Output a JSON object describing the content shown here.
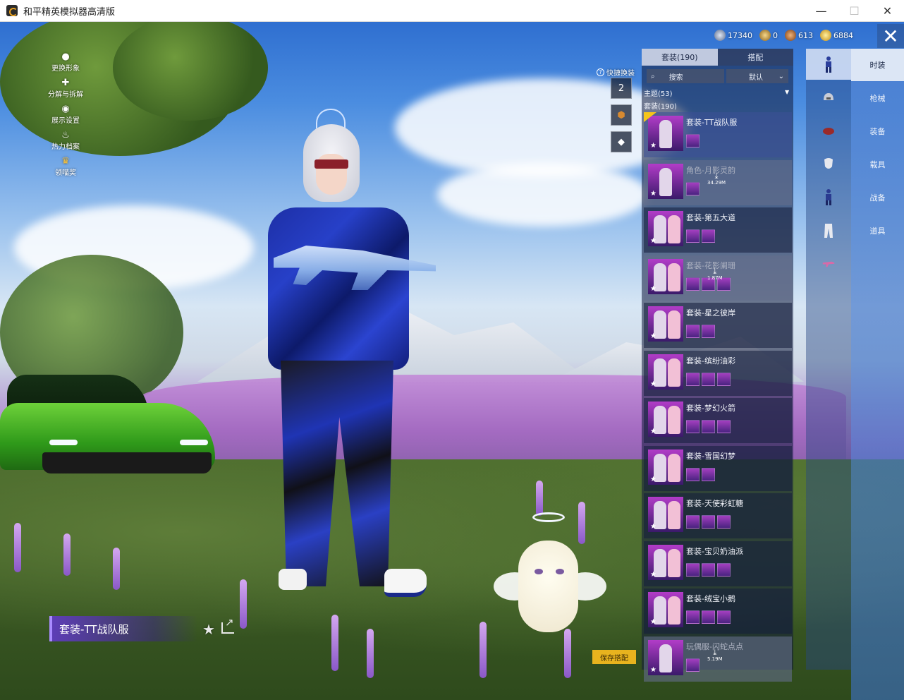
{
  "window": {
    "title": "和平精英模拟器高清版",
    "controls": {
      "minimize": "—",
      "maximize": "☐",
      "close": "✕"
    }
  },
  "left_menu": [
    {
      "icon": "person-icon",
      "label": "更换形象"
    },
    {
      "icon": "puzzle-icon",
      "label": "分解与拆解"
    },
    {
      "icon": "eye-icon",
      "label": "展示设置"
    },
    {
      "icon": "flame-icon",
      "label": "热力档案"
    },
    {
      "icon": "crown-icon",
      "label": "领喵奖"
    }
  ],
  "currencies": [
    {
      "icon": "silver-coin-icon",
      "value": "17340",
      "color": "#8aa0c8"
    },
    {
      "icon": "gold-badge-icon",
      "value": "0",
      "color": "#d8a83a"
    },
    {
      "icon": "bronze-coin-icon",
      "value": "613",
      "color": "#c07a3a"
    },
    {
      "icon": "gold-coin-icon",
      "value": "6884",
      "color": "#f0c030"
    }
  ],
  "quick_swap": {
    "label": "快捷换装",
    "slots": [
      "2",
      "",
      ""
    ]
  },
  "panel": {
    "tabs": [
      {
        "label": "套装(190)",
        "active": true
      },
      {
        "label": "搭配",
        "active": false
      }
    ],
    "search_label": "搜索",
    "sort_label": "默认",
    "theme_label": "主题(53)",
    "suit_label": "套装(190)",
    "items": [
      {
        "name": "套装-TT战队服",
        "chips": 1,
        "selected": true,
        "downloading": false,
        "size": ""
      },
      {
        "name": "角色-月影灵韵",
        "chips": 1,
        "selected": false,
        "downloading": true,
        "size": "34.29M"
      },
      {
        "name": "套装-第五大道",
        "chips": 2,
        "selected": false,
        "downloading": false,
        "size": ""
      },
      {
        "name": "套装-花影阑珊",
        "chips": 3,
        "selected": false,
        "downloading": true,
        "size": "1.87M"
      },
      {
        "name": "套装-星之彼岸",
        "chips": 2,
        "selected": false,
        "downloading": false,
        "size": ""
      },
      {
        "name": "套装-缤纷油彩",
        "chips": 3,
        "selected": false,
        "downloading": false,
        "size": ""
      },
      {
        "name": "套装-梦幻火箭",
        "chips": 3,
        "selected": false,
        "downloading": false,
        "size": ""
      },
      {
        "name": "套装-雪国幻梦",
        "chips": 2,
        "selected": false,
        "downloading": false,
        "size": ""
      },
      {
        "name": "套装-天使彩虹糖",
        "chips": 3,
        "selected": false,
        "downloading": false,
        "size": ""
      },
      {
        "name": "套装-宝贝奶油派",
        "chips": 3,
        "selected": false,
        "downloading": false,
        "size": ""
      },
      {
        "name": "套装-绒宝小鹅",
        "chips": 3,
        "selected": false,
        "downloading": false,
        "size": ""
      },
      {
        "name": "玩偶服-闪蛇点点",
        "chips": 1,
        "selected": false,
        "downloading": true,
        "size": "5.19M"
      }
    ]
  },
  "save_button": "保存搭配",
  "outfit_name": "套装-TT战队服",
  "categories": [
    {
      "icon": "outfit-icon",
      "active": true
    },
    {
      "icon": "helmet-icon",
      "active": false
    },
    {
      "icon": "backpack-icon",
      "active": false
    },
    {
      "icon": "mask-icon",
      "active": false
    },
    {
      "icon": "body-icon",
      "active": false
    },
    {
      "icon": "pants-icon",
      "active": false
    },
    {
      "icon": "gun-skin-icon",
      "active": false
    }
  ],
  "right_nav": [
    {
      "label": "时装",
      "active": true
    },
    {
      "label": "枪械",
      "active": false
    },
    {
      "label": "装备",
      "active": false
    },
    {
      "label": "载具",
      "active": false
    },
    {
      "label": "战备",
      "active": false
    },
    {
      "label": "道具",
      "active": false
    }
  ],
  "colors": {
    "accent_gold": "#e8b31e",
    "nav_active": "#dce6f5",
    "outfit_tag": "#5f3cbe"
  }
}
